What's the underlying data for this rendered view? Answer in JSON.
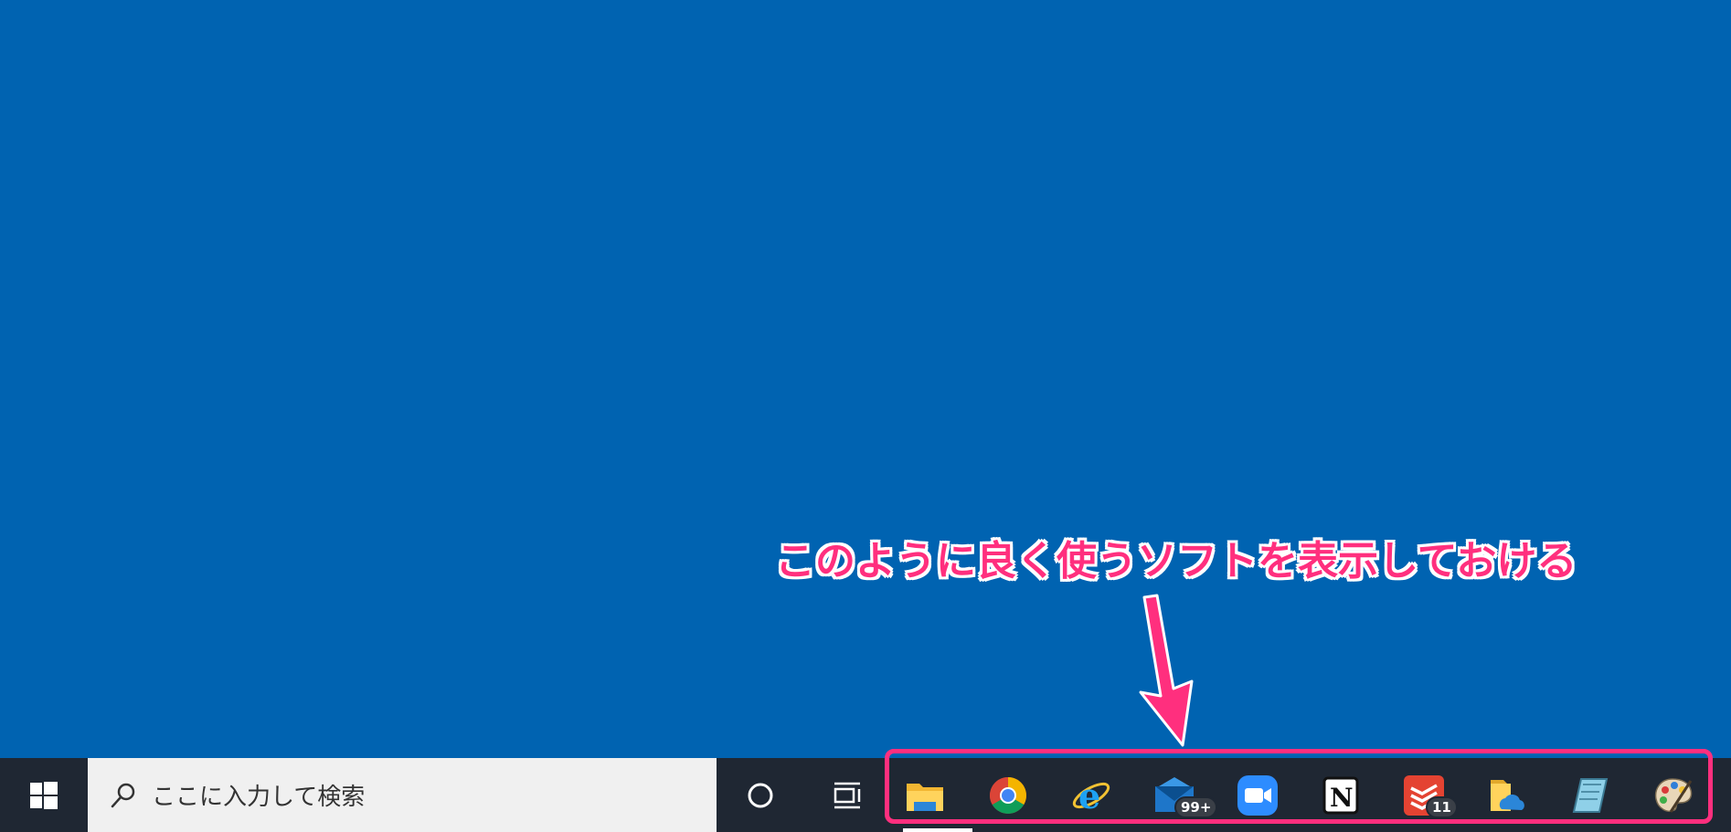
{
  "annotation": {
    "text": "このように良く使うソフトを表示しておける",
    "color": "#ff2f7e"
  },
  "taskbar": {
    "background": "#1f2733",
    "start_icon": "windows-logo-icon",
    "search": {
      "placeholder": "ここに入力して検索",
      "icon": "search-icon"
    },
    "cortana_icon": "cortana-circle-icon",
    "task_view_icon": "task-view-icon",
    "pinned_apps": [
      {
        "name": "file-explorer",
        "icon": "file-explorer-icon",
        "badge": ""
      },
      {
        "name": "chrome",
        "icon": "chrome-icon",
        "badge": ""
      },
      {
        "name": "internet-explorer",
        "icon": "internet-explorer-icon",
        "badge": ""
      },
      {
        "name": "mail",
        "icon": "mail-icon",
        "badge": "99+"
      },
      {
        "name": "zoom",
        "icon": "zoom-icon",
        "badge": ""
      },
      {
        "name": "notion",
        "icon": "notion-icon",
        "badge": ""
      },
      {
        "name": "todoist",
        "icon": "todoist-icon",
        "badge": "11"
      },
      {
        "name": "onedrive-folder",
        "icon": "onedrive-folder-icon",
        "badge": ""
      },
      {
        "name": "notebook-app",
        "icon": "notebook-app-icon",
        "badge": ""
      },
      {
        "name": "paint",
        "icon": "paint-palette-icon",
        "badge": ""
      }
    ]
  },
  "colors": {
    "desktop": "#0063b1",
    "highlight": "#ff2f7e"
  }
}
